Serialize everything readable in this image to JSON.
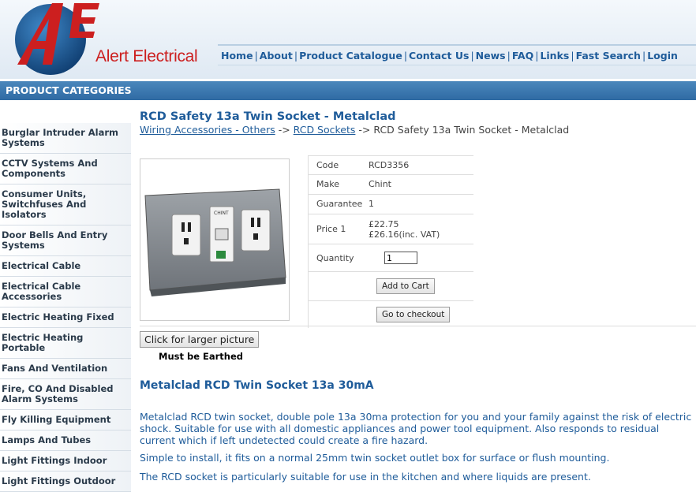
{
  "brand": {
    "logo_letters": "AE",
    "name": "Alert Electrical"
  },
  "nav": [
    "Home",
    "About",
    "Product Catalogue",
    "Contact Us",
    "News",
    "FAQ",
    "Links",
    "Fast Search",
    "Login"
  ],
  "sidebar": {
    "title": "PRODUCT CATEGORIES",
    "items": [
      "Burglar Intruder Alarm Systems",
      "CCTV Systems And Components",
      "Consumer Units, Switchfuses And Isolators",
      "Door Bells And Entry Systems",
      "Electrical Cable",
      "Electrical Cable Accessories",
      "Electric Heating Fixed",
      "Electric Heating Portable",
      "Fans And Ventilation",
      "Fire, CO And Disabled Alarm Systems",
      "Fly Killing Equipment",
      "Lamps And Tubes",
      "Light Fittings Indoor",
      "Light Fittings Outdoor"
    ]
  },
  "product": {
    "title": "RCD Safety 13a Twin Socket - Metalclad",
    "breadcrumb": {
      "cat1": "Wiring Accessories - Others",
      "sep": "->",
      "cat2": "RCD Sockets",
      "current": "RCD Safety 13a Twin Socket - Metalclad"
    },
    "code_label": "Code",
    "code": "RCD3356",
    "make_label": "Make",
    "make": "Chint",
    "guarantee_label": "Guarantee",
    "guarantee": "1",
    "price_label": "Price 1",
    "price": "£22.75",
    "price_vat": "£26.16(inc. VAT)",
    "qty_label": "Quantity",
    "qty_value": "1",
    "add_to_cart": "Add to Cart",
    "checkout": "Go to checkout",
    "larger_picture": "Click for larger picture",
    "note": "Must be Earthed",
    "image_brand_text": "CHINT"
  },
  "description": {
    "heading": "Metalclad RCD Twin Socket 13a 30mA",
    "p1": "Metalclad RCD twin socket, double pole 13a 30ma protection for you and your family against the risk of electric shock.  Suitable for use with all domestic appliances and power tool equipment.  Also responds to residual current which if left undetected could create a fire hazard.",
    "p2": "Simple to install, it fits on a normal 25mm twin socket outlet box for surface or flush mounting.",
    "p3": "The RCD socket is particularly suitable for use in the kitchen and where liquids are present."
  },
  "colors": {
    "link": "#1f5c9a",
    "logo_red": "#cc1f1f",
    "globe": "#1f5c9a",
    "bar": "#3a76ad"
  }
}
